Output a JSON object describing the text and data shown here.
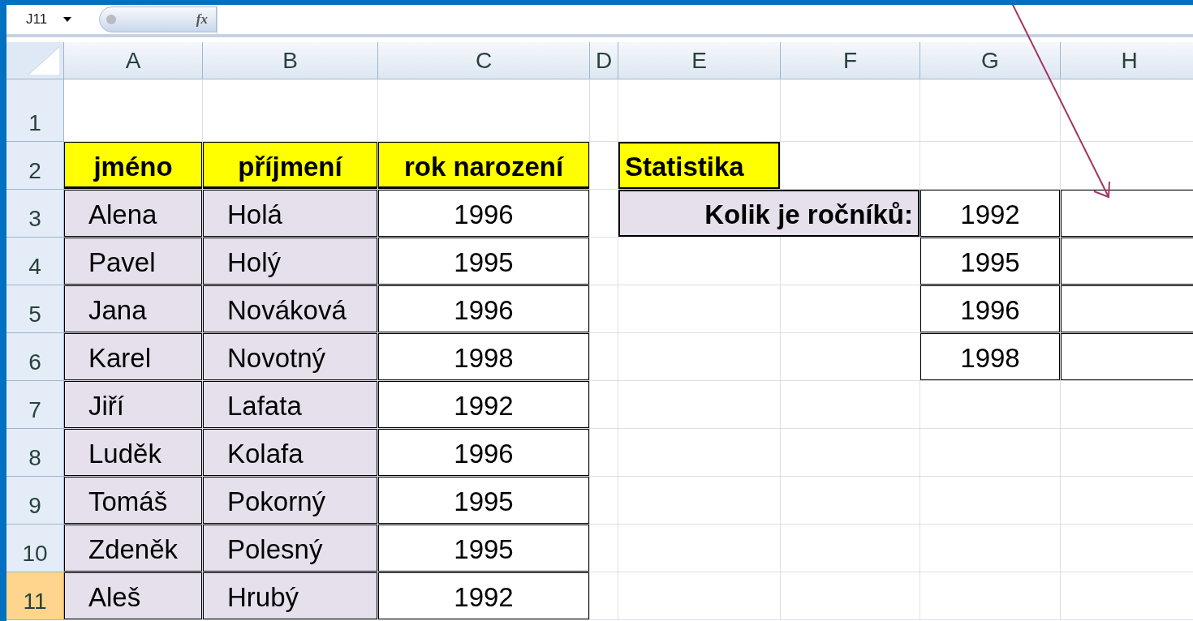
{
  "formula_bar": {
    "name_box": "J11",
    "function_symbol": "fx"
  },
  "columns": [
    {
      "label": "A",
      "selected": false
    },
    {
      "label": "B",
      "selected": false
    },
    {
      "label": "C",
      "selected": false
    },
    {
      "label": "D",
      "selected": false
    },
    {
      "label": "E",
      "selected": false
    },
    {
      "label": "F",
      "selected": false
    },
    {
      "label": "G",
      "selected": false
    },
    {
      "label": "H",
      "selected": false
    }
  ],
  "rows": [
    {
      "number": "1",
      "selected": false,
      "cells": [
        {
          "kind": "empty"
        },
        {
          "kind": "empty"
        },
        {
          "kind": "empty"
        },
        {
          "kind": "empty"
        },
        {
          "kind": "empty"
        },
        {
          "kind": "empty"
        },
        {
          "kind": "empty"
        },
        {
          "kind": "empty"
        }
      ]
    },
    {
      "number": "2",
      "selected": false,
      "cells": [
        {
          "kind": "heading",
          "text": "jméno"
        },
        {
          "kind": "heading",
          "text": "příjmení"
        },
        {
          "kind": "heading",
          "text": "rok narození"
        },
        {
          "kind": "empty"
        },
        {
          "kind": "title",
          "text": "Statistika"
        },
        {
          "kind": "empty"
        },
        {
          "kind": "empty"
        },
        {
          "kind": "empty"
        }
      ]
    },
    {
      "number": "3",
      "selected": false,
      "cells": [
        {
          "kind": "text",
          "text": "Alena"
        },
        {
          "kind": "text",
          "text": "Holá"
        },
        {
          "kind": "number",
          "text": "1996"
        },
        {
          "kind": "empty"
        },
        {
          "kind": "label",
          "text": "Kolik je ročníků:"
        },
        {
          "kind": "number",
          "text": "1992"
        },
        {
          "kind": "boxed"
        }
      ]
    },
    {
      "number": "4",
      "selected": false,
      "cells": [
        {
          "kind": "text",
          "text": "Pavel"
        },
        {
          "kind": "text",
          "text": "Holý"
        },
        {
          "kind": "number",
          "text": "1995"
        },
        {
          "kind": "empty"
        },
        {
          "kind": "empty"
        },
        {
          "kind": "empty"
        },
        {
          "kind": "number",
          "text": "1995"
        },
        {
          "kind": "boxed"
        }
      ]
    },
    {
      "number": "5",
      "selected": false,
      "cells": [
        {
          "kind": "text",
          "text": "Jana"
        },
        {
          "kind": "text",
          "text": "Nováková"
        },
        {
          "kind": "number",
          "text": "1996"
        },
        {
          "kind": "empty"
        },
        {
          "kind": "empty"
        },
        {
          "kind": "empty"
        },
        {
          "kind": "number",
          "text": "1996"
        },
        {
          "kind": "boxed"
        }
      ]
    },
    {
      "number": "6",
      "selected": false,
      "cells": [
        {
          "kind": "text",
          "text": "Karel"
        },
        {
          "kind": "text",
          "text": "Novotný"
        },
        {
          "kind": "number",
          "text": "1998"
        },
        {
          "kind": "empty"
        },
        {
          "kind": "empty"
        },
        {
          "kind": "empty"
        },
        {
          "kind": "number",
          "text": "1998"
        },
        {
          "kind": "boxed"
        }
      ]
    },
    {
      "number": "7",
      "selected": false,
      "cells": [
        {
          "kind": "text",
          "text": "Jiří"
        },
        {
          "kind": "text",
          "text": "Lafata"
        },
        {
          "kind": "number",
          "text": "1992"
        },
        {
          "kind": "empty"
        },
        {
          "kind": "empty"
        },
        {
          "kind": "empty"
        },
        {
          "kind": "empty"
        },
        {
          "kind": "empty"
        }
      ]
    },
    {
      "number": "8",
      "selected": false,
      "cells": [
        {
          "kind": "text",
          "text": "Luděk"
        },
        {
          "kind": "text",
          "text": "Kolafa"
        },
        {
          "kind": "number",
          "text": "1996"
        },
        {
          "kind": "empty"
        },
        {
          "kind": "empty"
        },
        {
          "kind": "empty"
        },
        {
          "kind": "empty"
        },
        {
          "kind": "empty"
        }
      ]
    },
    {
      "number": "9",
      "selected": false,
      "cells": [
        {
          "kind": "text",
          "text": "Tomáš"
        },
        {
          "kind": "text",
          "text": "Pokorný"
        },
        {
          "kind": "number",
          "text": "1995"
        },
        {
          "kind": "empty"
        },
        {
          "kind": "empty"
        },
        {
          "kind": "empty"
        },
        {
          "kind": "empty"
        },
        {
          "kind": "empty"
        }
      ]
    },
    {
      "number": "10",
      "selected": false,
      "cells": [
        {
          "kind": "text",
          "text": "Zdeněk"
        },
        {
          "kind": "text",
          "text": "Polesný"
        },
        {
          "kind": "number",
          "text": "1995"
        },
        {
          "kind": "empty"
        },
        {
          "kind": "empty"
        },
        {
          "kind": "empty"
        },
        {
          "kind": "empty"
        },
        {
          "kind": "empty"
        }
      ]
    },
    {
      "number": "11",
      "selected": true,
      "cells": [
        {
          "kind": "text",
          "text": "Aleš"
        },
        {
          "kind": "text",
          "text": "Hrubý"
        },
        {
          "kind": "number",
          "text": "1992"
        },
        {
          "kind": "empty"
        },
        {
          "kind": "empty"
        },
        {
          "kind": "empty"
        },
        {
          "kind": "empty"
        },
        {
          "kind": "empty"
        }
      ]
    }
  ]
}
